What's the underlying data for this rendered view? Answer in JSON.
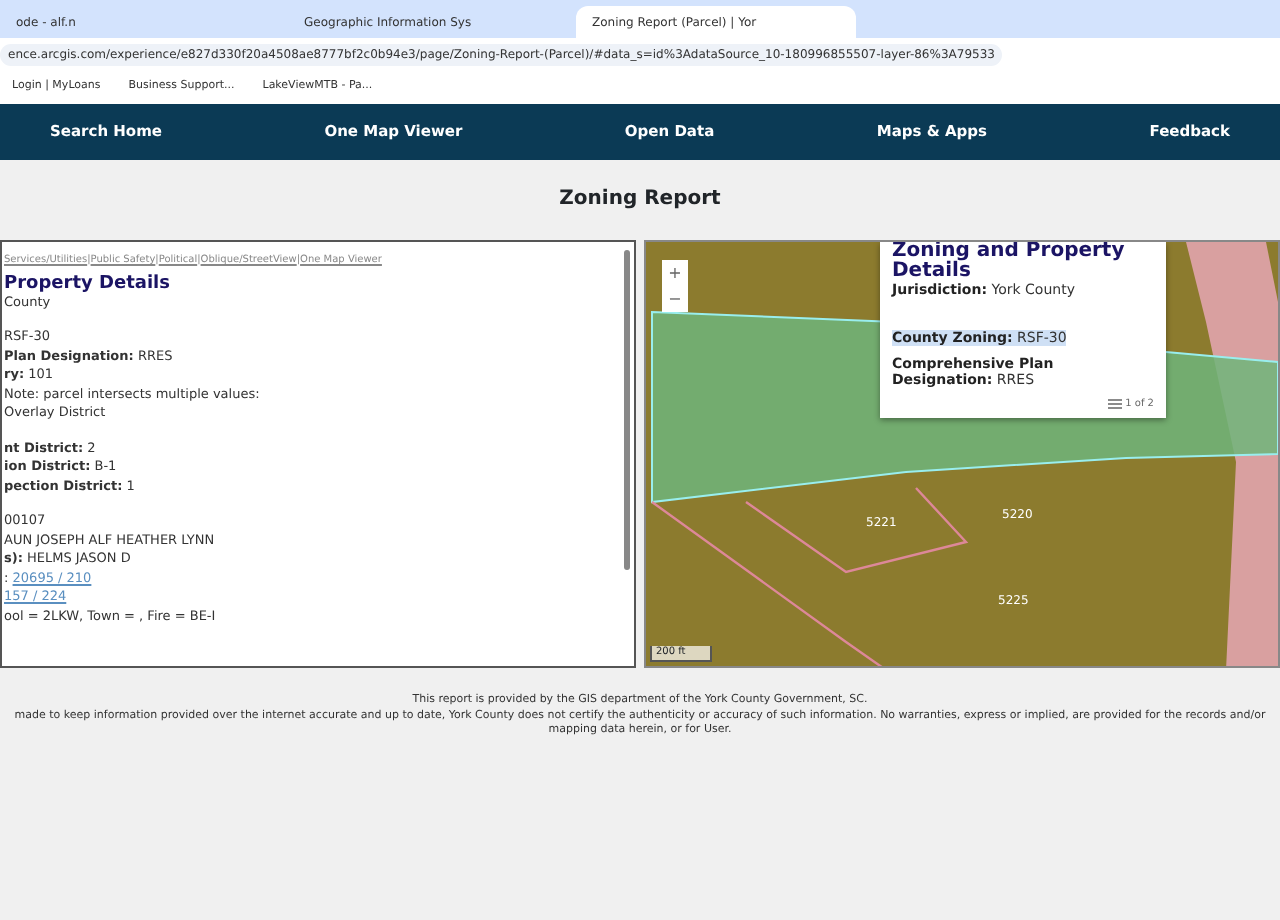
{
  "browser": {
    "tabs": [
      {
        "label": "ode - alf.n",
        "selected": false
      },
      {
        "label": "Geographic Information Sys",
        "selected": false
      },
      {
        "label": "Zoning Report (Parcel) | Yor",
        "selected": true
      }
    ],
    "url": "ence.arcgis.com/experience/e827d330f20a4508ae8777bf2c0b94e3/page/Zoning-Report-(Parcel)/#data_s=id%3AdataSource_10-180996855507-layer-86%3A79533",
    "bookmarks": [
      "Login | MyLoans",
      "Business Support...",
      "LakeViewMTB - Pa..."
    ]
  },
  "nav": [
    "Search Home",
    "One Map Viewer",
    "Open Data",
    "Maps & Apps",
    "Feedback"
  ],
  "page_title": "Zoning Report",
  "details": {
    "link_separator": "|",
    "links": [
      "Services/Utilities",
      "Public Safety",
      "Political",
      "Oblique/StreetView",
      "One Map Viewer"
    ],
    "heading": "Property Details",
    "groups": [
      [
        "County"
      ],
      [
        "RSF-30",
        "**Plan Designation:** RRES",
        "**ry:** 101",
        "Note: parcel intersects multiple values:",
        "Overlay District"
      ],
      [
        "**nt District:** 2",
        "**ion District:** B-1",
        "**pection District:** 1"
      ],
      [
        "00107",
        "AUN JOSEPH ALF HEATHER LYNN",
        "**s):** HELMS JASON D",
        {
          "prefix": ":",
          "link": "20695 / 210"
        },
        {
          "link": "157 / 224"
        },
        "ool = 2LKW, Town = , Fire = BE-I"
      ]
    ]
  },
  "map": {
    "popup": {
      "title": "Zoning and Property Details",
      "lines": [
        {
          "text": "**Jurisdiction:** York County",
          "highlighted": false
        },
        {
          "text": "**County Zoning:** RSF-30",
          "highlighted": true
        },
        {
          "text": "**Comprehensive Plan Designation:** RRES",
          "highlighted": false
        }
      ],
      "pager": "1 of 2"
    },
    "zoom": [
      "+",
      "−"
    ],
    "labels": [
      "5221",
      "5220",
      "5225"
    ],
    "scale": "200 ft"
  },
  "footer": [
    "This report is provided by the GIS department of the York County Government, SC.",
    "made to keep information provided over the internet accurate and up to date, York County does not certify the authenticity or accuracy of such information. No warranties, express or implied, are provided for the records and/or mapping data herein, or for User."
  ]
}
